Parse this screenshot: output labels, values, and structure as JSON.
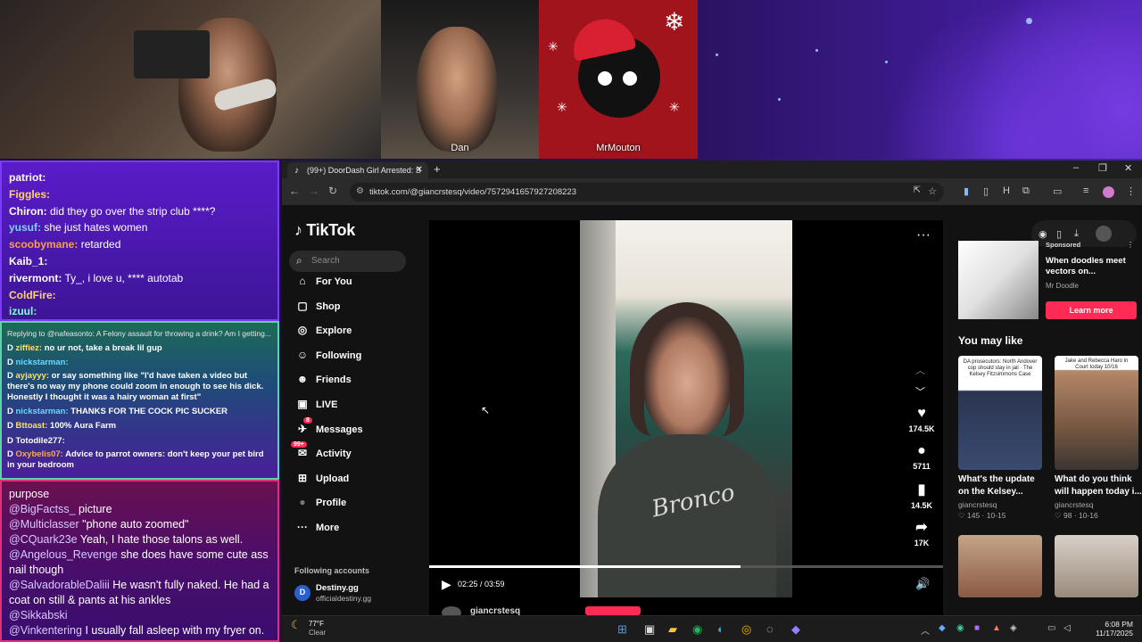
{
  "overlay": {
    "cams": [
      {
        "label": ""
      },
      {
        "label": "Dan"
      },
      {
        "label": "MrMouton"
      }
    ]
  },
  "chat_top": [
    {
      "user": "patriot:",
      "msg": "",
      "color": "#ffffff"
    },
    {
      "user": "Figgles:",
      "msg": "",
      "color": "#ffd36a"
    },
    {
      "user": "Chiron:",
      "msg": "did they go over the strip club ****?",
      "color": "#ffffff"
    },
    {
      "user": "yusuf:",
      "msg": "she just hates women",
      "color": "#7fd0ff"
    },
    {
      "user": "scoobymane:",
      "msg": "retarded",
      "color": "#ff9f3a"
    },
    {
      "user": "Kaib_1:",
      "msg": "",
      "color": "#ffffff"
    },
    {
      "user": "rivermont:",
      "msg": "Ty_, i love u, **** autotab",
      "color": "#ffffff"
    },
    {
      "user": "ColdFire:",
      "msg": "",
      "color": "#ffd36a"
    },
    {
      "user": "izuul:",
      "msg": "",
      "color": "#7fffd4"
    }
  ],
  "chat_mid": {
    "reply": "Replying to @nafeasonto: A Felony assault for throwing a drink? Am I getting...",
    "lines": [
      {
        "user": "ziffiez:",
        "msg": "no ur not, take a break lil gup",
        "color": "#ffe066"
      },
      {
        "user": "nickstarman:",
        "msg": "",
        "color": "#66d9ff"
      },
      {
        "user": "ayjayyy:",
        "msg": "or say something like \"I'd have taken a video but there's no way my phone could zoom in enough to see his dick. Honestly I thought it was a hairy woman at first\"",
        "color": "#ffe066"
      },
      {
        "user": "nickstarman:",
        "msg": "THANKS FOR THE COCK PIC SUCKER",
        "color": "#66d9ff"
      },
      {
        "user": "Bttoast:",
        "msg": "100% Aura Farm",
        "color": "#ffe066"
      },
      {
        "user": "Totodile277:",
        "msg": "",
        "color": "#ffffff"
      },
      {
        "user": "Oxybelis07:",
        "msg": "Advice to parrot owners: don't keep your pet bird in your bedroom",
        "color": "#ffa94d"
      }
    ]
  },
  "chat_bot": [
    {
      "user": "",
      "msg": "purpose"
    },
    {
      "user": "@BigFactss_",
      "msg": "picture"
    },
    {
      "user": "@Multiclasser",
      "msg": "\"phone auto zoomed\""
    },
    {
      "user": "@CQuark23e",
      "msg": "Yeah, I hate those talons as well."
    },
    {
      "user": "@Angelous_Revenge",
      "msg": "she does have some cute ass nail though"
    },
    {
      "user": "@SalvadorableDaliii",
      "msg": "He wasn't fully naked. He had a coat on still & pants at his ankles"
    },
    {
      "user": "@Sikkabski",
      "msg": ""
    },
    {
      "user": "@Vinkentering",
      "msg": "I usually fall asleep with my fryer on."
    }
  ],
  "browser": {
    "tab_title": "(99+) DoorDash Girl Arrested: S",
    "url": "tiktok.com/@giancrstesq/video/7572941657927208223"
  },
  "tiktok": {
    "logo": "TikTok",
    "search_placeholder": "Search",
    "nav": [
      {
        "icon": "home-icon",
        "glyph": "⌂",
        "label": "For You"
      },
      {
        "icon": "shop-icon",
        "glyph": "▢",
        "label": "Shop"
      },
      {
        "icon": "compass-icon",
        "glyph": "◎",
        "label": "Explore"
      },
      {
        "icon": "following-icon",
        "glyph": "☺",
        "label": "Following"
      },
      {
        "icon": "friends-icon",
        "glyph": "☻",
        "label": "Friends"
      },
      {
        "icon": "live-icon",
        "glyph": "▣",
        "label": "LIVE"
      },
      {
        "icon": "messages-icon",
        "glyph": "✈",
        "label": "Messages"
      },
      {
        "icon": "activity-icon",
        "glyph": "✉",
        "label": "Activity"
      },
      {
        "icon": "upload-icon",
        "glyph": "⊞",
        "label": "Upload"
      },
      {
        "icon": "avatar",
        "glyph": "●",
        "label": "Profile"
      },
      {
        "icon": "more-icon",
        "glyph": "···",
        "label": "More"
      }
    ],
    "messages_badge": "8",
    "activity_badge": "99+",
    "following_accounts": "Following accounts",
    "account": {
      "name": "Destiny.gg",
      "handle": "officialdestiny.gg"
    },
    "player": {
      "time": "02:25 / 03:59",
      "progress": 0.606,
      "shirt_text": "Bronco",
      "author": "giancrstesq"
    },
    "actions": {
      "likes": "174.5K",
      "comments": "5711",
      "saves": "14.5K",
      "shares": "17K"
    },
    "ad": {
      "sponsored": "Sponsored",
      "title": "When doodles meet vectors on...",
      "source": "Mr Doodle",
      "button": "Learn more"
    },
    "you_may_like": "You may like",
    "cards": [
      {
        "title": "What's the update on the Kelsey...",
        "author": "giancrstesq",
        "likes": "145",
        "date": "10-15",
        "thumb": "DA prosecutors: North Andover cop should stay in jail · The Kelsey Fitzsimmons Case"
      },
      {
        "title": "What do you think will happen today i...",
        "author": "giancrstesq",
        "likes": "98",
        "date": "10-16",
        "thumb": "Jake and Rebecca Haro in Court today 10/16"
      }
    ]
  },
  "taskbar": {
    "temp": "77°F",
    "weather": "Clear",
    "time": "6:08 PM",
    "date": "11/17/2025"
  }
}
